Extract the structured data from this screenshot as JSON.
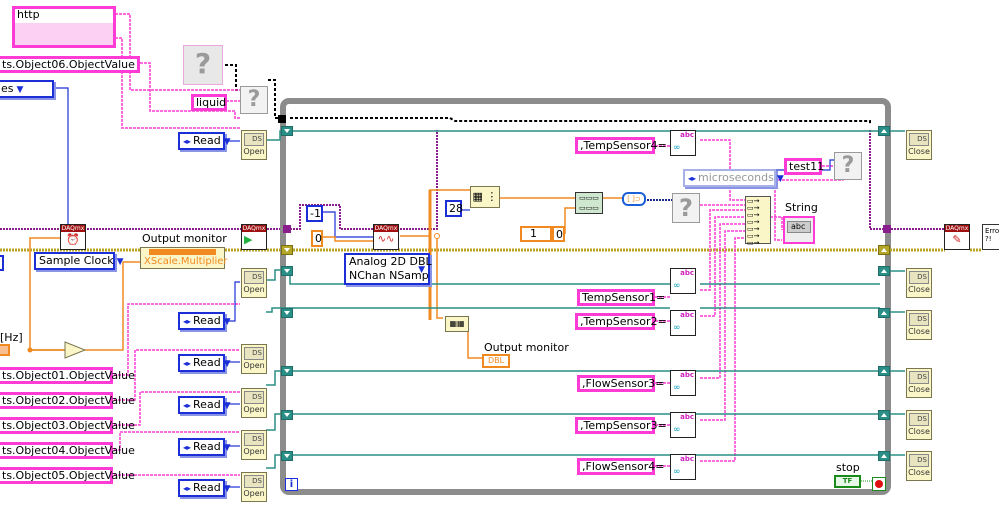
{
  "diagram": {
    "type": "LabVIEW block diagram",
    "url_constant_prefix": "http",
    "left_constants": [
      "ts.Object06.ObjectValue",
      "ts.Object01.ObjectValue",
      "ts.Object02.ObjectValue",
      "ts.Object03.ObjectValue",
      "ts.Object04.ObjectValue",
      "ts.Object05.ObjectValue"
    ],
    "top_ring_partial": "es",
    "liquid_constant": "liquid",
    "read_modes": [
      "Read",
      "Read",
      "Read",
      "Read",
      "Read",
      "Read"
    ],
    "open_label": "Open",
    "close_label": "Close",
    "ds_label": "DS",
    "sample_clock": "Sample Clock",
    "output_monitor_title": "Output monitor",
    "xscale_property": "XScale.Multiplier",
    "rate_label_partial": "[Hz]",
    "daqmx_label": "DAQmx",
    "const_minus1": "-1",
    "const_zero": "0",
    "read_polymorph": [
      "Analog 2D DBL",
      "NChan NSamp"
    ],
    "const_28": "28",
    "array_index_1": "1",
    "array_index_0": "0",
    "output_monitor_local_label": "Output monitor",
    "output_monitor_type": "DBL",
    "time_unit": "microseconds",
    "test_constant": "test11",
    "string_indicator_label": "String",
    "string_indicator_type": "abc",
    "sensor_constants": [
      ",TempSensor4=",
      "TempSensor1=",
      ",TempSensor2=",
      ",FlowSensor3=",
      ",TempSensor3=",
      ",FlowSensor4="
    ],
    "stop_label": "stop",
    "stop_value": "TF",
    "loop_iteration": "i",
    "error_label": "Error ?!",
    "abc_glyph": "abc",
    "unknown_glyph": "?"
  }
}
